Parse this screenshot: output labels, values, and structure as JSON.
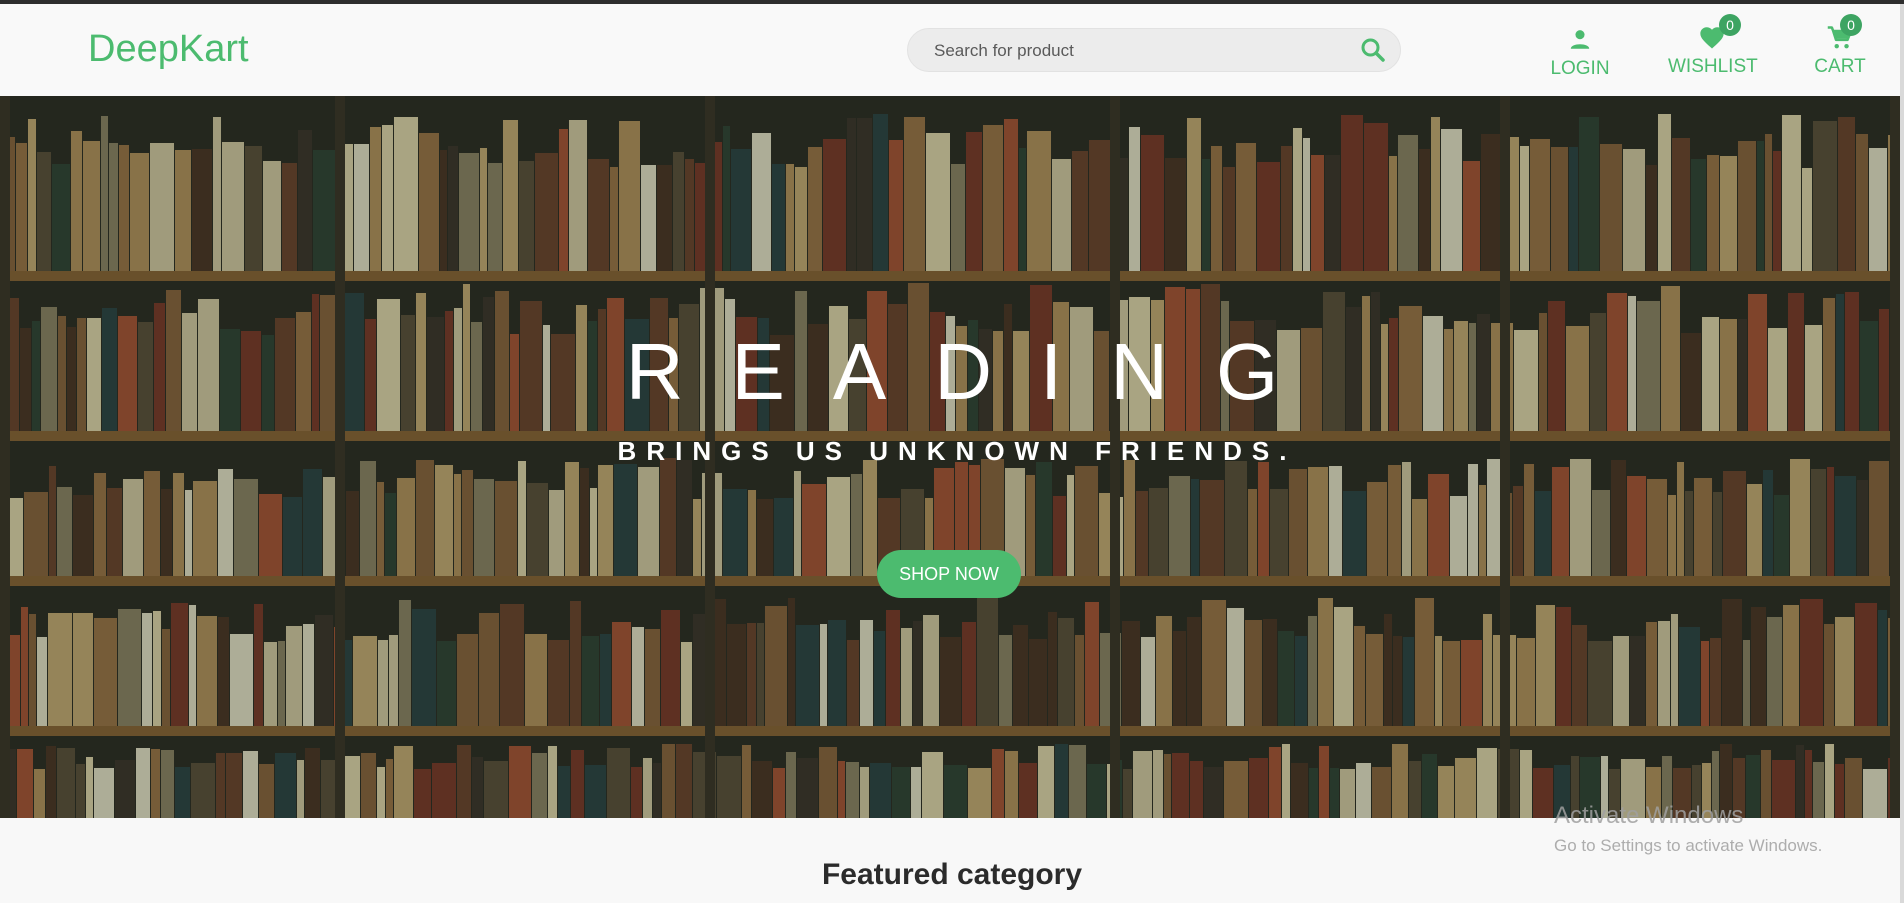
{
  "brand": {
    "name": "DeepKart",
    "accent_color": "#4cbb6f"
  },
  "search": {
    "placeholder": "Search for product",
    "icon": "search-icon"
  },
  "nav": {
    "login": {
      "label": "LOGIN",
      "icon": "person-icon"
    },
    "wishlist": {
      "label": "WISHLIST",
      "icon": "heart-icon",
      "count": "0"
    },
    "cart": {
      "label": "CART",
      "icon": "cart-icon",
      "count": "0"
    }
  },
  "hero": {
    "title": "READING",
    "subtitle": "BRINGS US UNKNOWN FRIENDS.",
    "cta_label": "SHOP NOW"
  },
  "featured": {
    "heading": "Featured category"
  },
  "os_watermark": {
    "line1": "Activate Windows",
    "line2": "Go to Settings to activate Windows."
  }
}
